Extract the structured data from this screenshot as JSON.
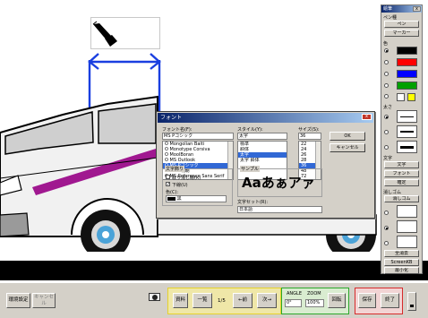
{
  "palette": {
    "title": "絵筆",
    "pen_type_label": "ペン種",
    "pen_button": "ペン",
    "marker_button": "マーカー",
    "color_label": "色",
    "colors": [
      "#000000",
      "#ff0000",
      "#0000ff",
      "#00a000",
      "#ffff00"
    ],
    "stroke_label": "太さ",
    "text_label": "文字",
    "text_button": "文字",
    "font_button": "フォント",
    "confirm_button": "確定",
    "eraser_label": "消しゴム",
    "eraser_button": "消しゴム",
    "clear_all_button": "全消去",
    "screen_kb_button": "ScreenKB",
    "minimize_button": "最小化"
  },
  "font_dialog": {
    "title": "フォント",
    "font_name_label": "フォント名(F):",
    "font_name_value": "MS Pゴシック",
    "fonts": [
      "Mongolian Baiti",
      "Monotype Corsiva",
      "MoolBoran",
      "MS Outlook",
      "MS Pゴシック",
      "MS P明朝",
      "MS Reference Sans Serif"
    ],
    "selected_font_index": 4,
    "style_label": "スタイル(Y):",
    "style_value": "太字",
    "styles": [
      "標準",
      "斜体",
      "太字",
      "太字 斜体"
    ],
    "selected_style_index": 2,
    "size_label": "サイズ(S):",
    "size_value": "36",
    "sizes": [
      "22",
      "24",
      "26",
      "28",
      "36",
      "48",
      "72"
    ],
    "selected_size_index": 4,
    "ok_button": "OK",
    "cancel_button": "キャンセル",
    "effects_label": "文字飾り",
    "strikeout_label": "取り消し線(K)",
    "underline_label": "下線(U)",
    "color_label": "色(C):",
    "color_value": "黒",
    "sample_label": "サンプル",
    "sample_text": "Aaあぁアァ",
    "charset_label": "文字セット(R):",
    "charset_value": "日本語"
  },
  "toolbar": {
    "env_settings_button": "環境設定",
    "cancel_button": "キャンセル",
    "material_button": "資料",
    "list_button": "一覧",
    "page_indicator": "1/5",
    "prev_button": "←前",
    "next_button": "次→",
    "angle_label": "ANGLE",
    "angle_value": "0°",
    "zoom_label": "ZOOM",
    "zoom_value": "100%",
    "rotate_button": "回転",
    "save_button": "保存",
    "exit_button": "終了"
  }
}
